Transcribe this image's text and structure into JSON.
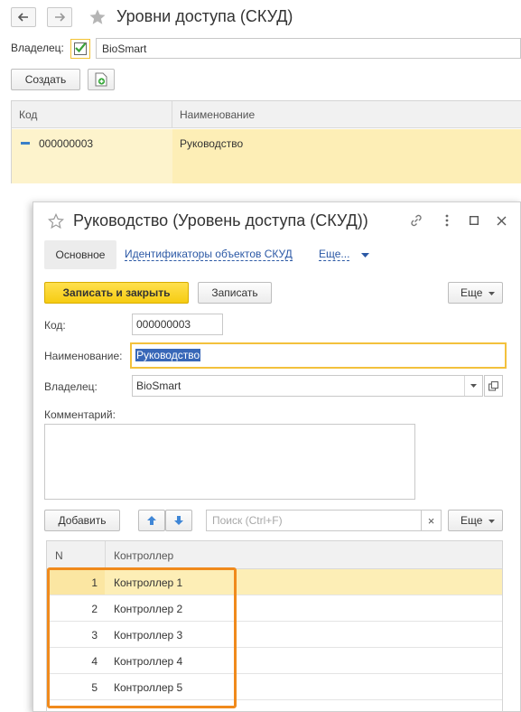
{
  "list_window": {
    "title": "Уровни доступа (СКУД)",
    "owner_label": "Владелец:",
    "owner_value": "BioSmart",
    "create_button": "Создать",
    "columns": [
      "Код",
      "Наименование"
    ],
    "rows": [
      {
        "code": "000000003",
        "name": "Руководство"
      }
    ],
    "icons": [
      "back-arrow-icon",
      "forward-arrow-icon",
      "star-icon",
      "checkbox-icon",
      "copy-add-icon",
      "minus-marker-icon"
    ]
  },
  "dialog": {
    "title": "Руководство (Уровень доступа (СКУД))",
    "tabs": {
      "main": "Основное",
      "identifiers": "Идентификаторы объектов СКУД",
      "more": "Еще..."
    },
    "toolbar": {
      "save_close": "Записать и закрыть",
      "save": "Записать",
      "more": "Еще"
    },
    "fields": {
      "code_label": "Код:",
      "code_value": "000000003",
      "name_label": "Наименование:",
      "name_value": "Руководство",
      "owner_label": "Владелец:",
      "owner_value": "BioSmart",
      "comment_label": "Комментарий:",
      "comment_value": ""
    },
    "table_toolbar": {
      "add": "Добавить",
      "search_placeholder": "Поиск (Ctrl+F)",
      "clear": "×",
      "more": "Еще"
    },
    "grid": {
      "columns": [
        "N",
        "Контроллер"
      ],
      "rows": [
        {
          "n": "1",
          "controller": "Контроллер 1"
        },
        {
          "n": "2",
          "controller": "Контроллер 2"
        },
        {
          "n": "3",
          "controller": "Контроллер 3"
        },
        {
          "n": "4",
          "controller": "Контроллер 4"
        },
        {
          "n": "5",
          "controller": "Контроллер 5"
        }
      ]
    },
    "icons": [
      "star-icon",
      "link-icon",
      "more-vertical-icon",
      "maximize-icon",
      "close-icon",
      "arrow-up-icon",
      "arrow-down-icon",
      "chevron-down-icon",
      "open-form-icon"
    ]
  },
  "colors": {
    "accent_yellow": "#f6cc12",
    "selected_row": "#fdeeb6",
    "link_blue": "#2b58a5",
    "highlight_orange": "#f08a1c",
    "arrow_blue": "#3f86d6"
  }
}
